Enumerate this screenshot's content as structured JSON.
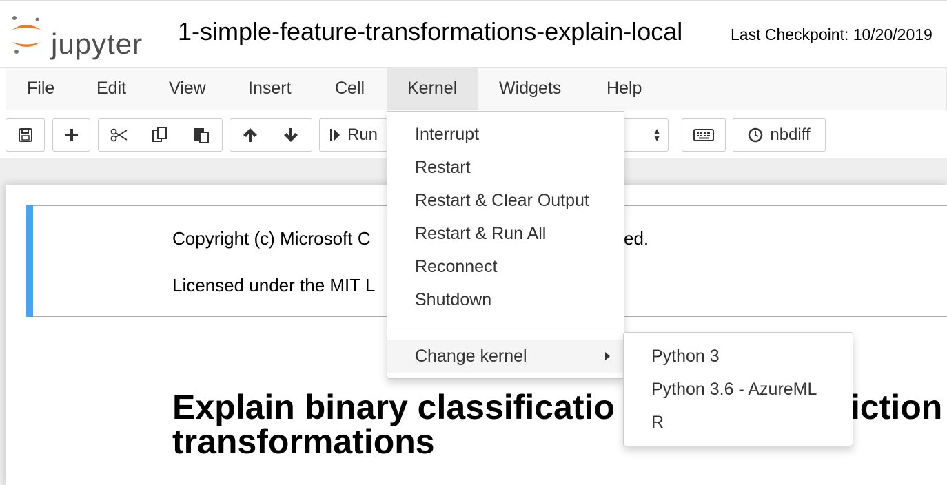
{
  "header": {
    "logo_text": "jupyter",
    "notebook_title": "1-simple-feature-transformations-explain-local",
    "checkpoint": "Last Checkpoint: 10/20/2019"
  },
  "menubar": {
    "items": [
      "File",
      "Edit",
      "View",
      "Insert",
      "Cell",
      "Kernel",
      "Widgets",
      "Help"
    ],
    "open_menu": "Kernel"
  },
  "toolbar": {
    "run_label": "Run",
    "nbdiff_label": "nbdiff",
    "icons": [
      "save-icon",
      "plus-icon",
      "scissors-icon",
      "copy-icon",
      "paste-icon",
      "arrow-up-icon",
      "arrow-down-icon",
      "step-forward-icon",
      "keyboard-icon",
      "clock-icon"
    ]
  },
  "kernel_menu": {
    "items": [
      "Interrupt",
      "Restart",
      "Restart & Clear Output",
      "Restart & Run All",
      "Reconnect",
      "Shutdown"
    ],
    "change_kernel": "Change kernel",
    "submenu": [
      "Python 3",
      "Python 3.6 - AzureML",
      "R"
    ]
  },
  "notebook": {
    "copyright_visible": "Copyright (c) Microsoft C",
    "copyright_tail": "ed.",
    "license_visible": "Licensed under the MIT L",
    "heading_line1_left": "Explain binary classificatio",
    "heading_line1_right": "iction",
    "heading_line2": "transformations"
  },
  "colors": {
    "logo_orange": "#f37726",
    "selected_cell_bar": "#42a5f5",
    "menu_hover": "#e7e7e7"
  }
}
